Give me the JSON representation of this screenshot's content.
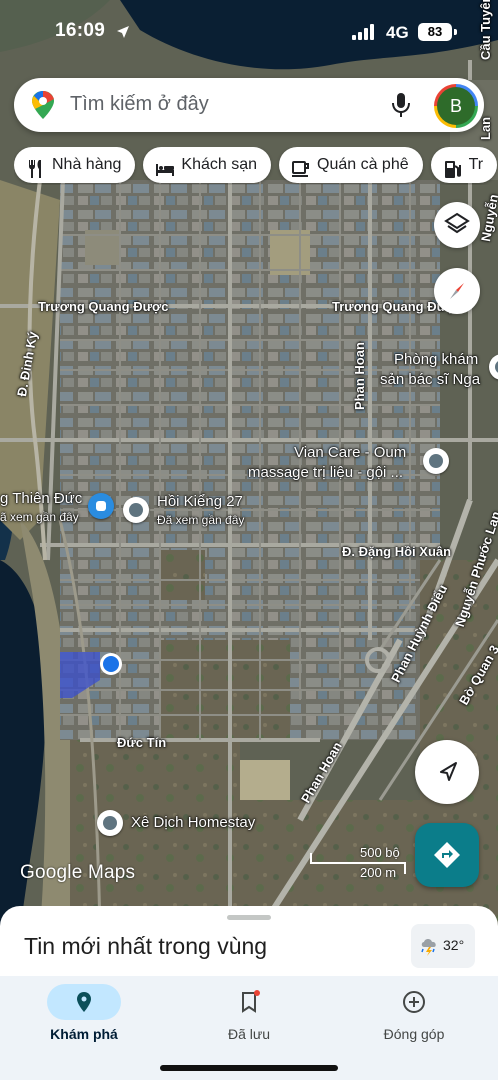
{
  "status_bar": {
    "time": "16:09",
    "network": "4G",
    "battery": "83"
  },
  "search": {
    "placeholder": "Tìm kiếm ở đây",
    "avatar_letter": "B"
  },
  "chips": [
    {
      "label": "Nhà hàng",
      "icon": "fork-knife-icon"
    },
    {
      "label": "Khách sạn",
      "icon": "bed-icon"
    },
    {
      "label": "Quán cà phê",
      "icon": "coffee-cup-icon"
    },
    {
      "label": "Tr",
      "icon": "gas-station-icon"
    }
  ],
  "map": {
    "streets": {
      "truong_quang_duoc_left": "Trương Quang Được",
      "truong_quang_duoc_right": "Trương Quang Được",
      "dinh_ky": "Đ. Đinh Ký",
      "phan_hoan_north": "Phan Hoan",
      "phan_hoan_south": "Phan Hoan",
      "dang_hoi_xuan": "Đ. Đặng Hồi Xuân",
      "phan_huynh_dieu": "Phan Huỳnh Điểu",
      "nguyen_phuoc_lan": "Nguyễn Phước Lan",
      "nguyen_top": "Nguyễn",
      "bo_quan_3": "Bờ Quan 3",
      "duc_tin": "Đức Tín",
      "cau_tuyen": "Cầu Tuyên",
      "lan_top": "Lan"
    },
    "pois": {
      "phong_kham_line1": "Phòng khám",
      "phong_kham_line2": "sản bác sĩ Nga",
      "vian_line1": "Vian Care - Oum",
      "vian_line2": "massage trị liệu - gội ...",
      "thien_duc_line1": "g Thiên Đức",
      "thien_duc_line2": "ã xem gần đây",
      "hoi_kieng_line1": "Hồi Kiểng 27",
      "hoi_kieng_line2": "Đã xem gần đây",
      "xe_dich": "Xê Dịch Homestay"
    },
    "scale": {
      "feet": "500 bộ",
      "meters": "200 m"
    },
    "attribution": "Google Maps"
  },
  "sheet": {
    "title": "Tin mới nhất trong vùng",
    "temperature": "32°",
    "weather_icon": "thunderstorm-icon"
  },
  "nav": [
    {
      "label": "Khám phá",
      "icon": "location-pin-icon",
      "active": true
    },
    {
      "label": "Đã lưu",
      "icon": "bookmark-icon",
      "active": false
    },
    {
      "label": "Đóng góp",
      "icon": "add-circle-icon",
      "active": false
    }
  ],
  "colors": {
    "accent_teal": "#0b7d8a",
    "active_pill": "#c2e7ff",
    "location_blue": "#1a73e8",
    "river": "#0a1f33"
  }
}
